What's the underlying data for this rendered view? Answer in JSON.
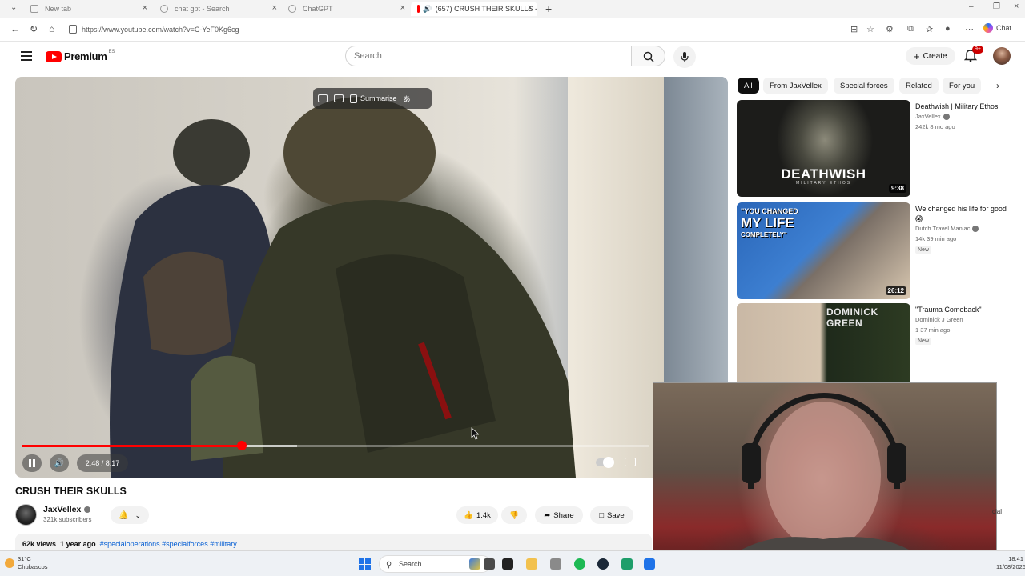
{
  "browser": {
    "tabs": [
      {
        "title": "New tab",
        "active": false
      },
      {
        "title": "chat gpt - Search",
        "active": false
      },
      {
        "title": "ChatGPT",
        "active": false
      },
      {
        "title": "(657) CRUSH THEIR SKULLS -",
        "active": true
      }
    ],
    "new_tab_icon": "+",
    "url": "https://www.youtube.com/watch?v=C-YeF0Kg6cg",
    "copilot_label": "Chat"
  },
  "header": {
    "logo_text": "Premium",
    "logo_sup": "ES",
    "search_placeholder": "Search",
    "create_label": "Create",
    "notif_count": "9+"
  },
  "player": {
    "toolbar_label": "Summarise",
    "time": "2:48 / 8:17",
    "progress": 0.35
  },
  "video": {
    "title": "CRUSH THEIR SKULLS",
    "channel": "JaxVellex",
    "subscribers": "321k subscribers",
    "likes": "1.4k",
    "share_label": "Share",
    "save_label": "Save",
    "views": "62k views",
    "age": "1 year ago",
    "tags": "#specialoperations #specialforces #military"
  },
  "chips": [
    {
      "label": "All",
      "active": true
    },
    {
      "label": "From JaxVellex",
      "active": false
    },
    {
      "label": "Special forces",
      "active": false
    },
    {
      "label": "Related",
      "active": false
    },
    {
      "label": "For you",
      "active": false
    }
  ],
  "recommendations": [
    {
      "title": "Deathwish | Military Ethos",
      "channel": "JaxVellex",
      "meta": "242k  8 mo ago",
      "duration": "9:38",
      "thumb_text": "DEATHWISH",
      "thumb_subtext": "MILITARY ETHOS",
      "badge": ""
    },
    {
      "title": "We changed his life for good 😱",
      "channel": "Dutch Travel Maniac",
      "meta": "14k  39 min ago",
      "duration": "26:12",
      "thumb_line1": "\"YOU CHANGED",
      "thumb_line2": "MY LIFE",
      "thumb_line3": "COMPLETELY\"",
      "badge": "New"
    },
    {
      "title": "\"Trauma Comeback\"",
      "channel": "Dominick J Green",
      "meta": "1  37 min ago",
      "duration": "",
      "thumb_text": "DOMINICK   GREEN",
      "badge": "New"
    }
  ],
  "webcam": {
    "edge_text": "cial"
  },
  "taskbar": {
    "temperature": "31°C",
    "weather": "Chubascos",
    "search_label": "Search",
    "time": "18:41",
    "date": "11/08/2026"
  },
  "colors": {
    "youtube_red": "#ff0000",
    "progress": "#ff0000",
    "link_blue": "#065fd4",
    "windows_blue": "#1f73e8"
  }
}
